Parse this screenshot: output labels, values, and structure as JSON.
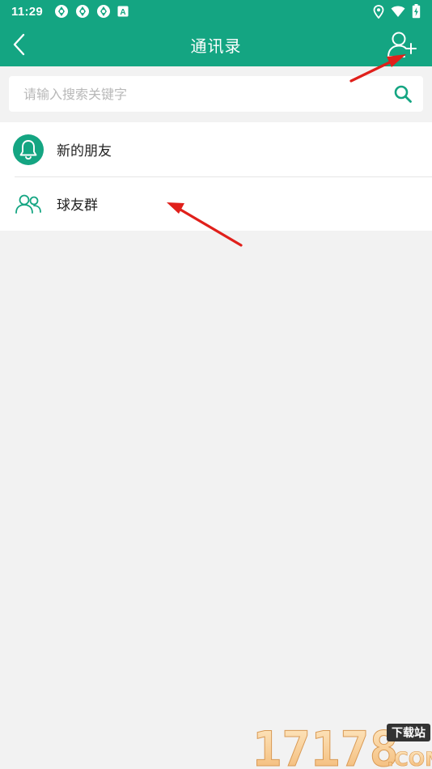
{
  "status_bar": {
    "time": "11:29",
    "left_icons": [
      "app-notification-icon",
      "app-notification-icon",
      "app-notification-icon",
      "a-badge-icon"
    ],
    "right_icons": [
      "location-icon",
      "wifi-icon",
      "battery-charging-icon"
    ],
    "a_badge": "A"
  },
  "app_bar": {
    "title": "通讯录",
    "back_icon": "chevron-left-icon",
    "add_icon": "add-user-icon"
  },
  "search": {
    "placeholder": "请输入搜索关键字",
    "value": "",
    "icon": "search-icon"
  },
  "list": {
    "items": [
      {
        "label": "新的朋友",
        "icon": "bell-icon"
      },
      {
        "label": "球友群",
        "icon": "group-icon"
      }
    ]
  },
  "watermark": {
    "number": "17178",
    "badge": "下载站",
    "suffix": ".COM"
  },
  "colors": {
    "primary": "#14a582",
    "background": "#f2f2f2",
    "annotation_arrow": "#e0201b"
  }
}
